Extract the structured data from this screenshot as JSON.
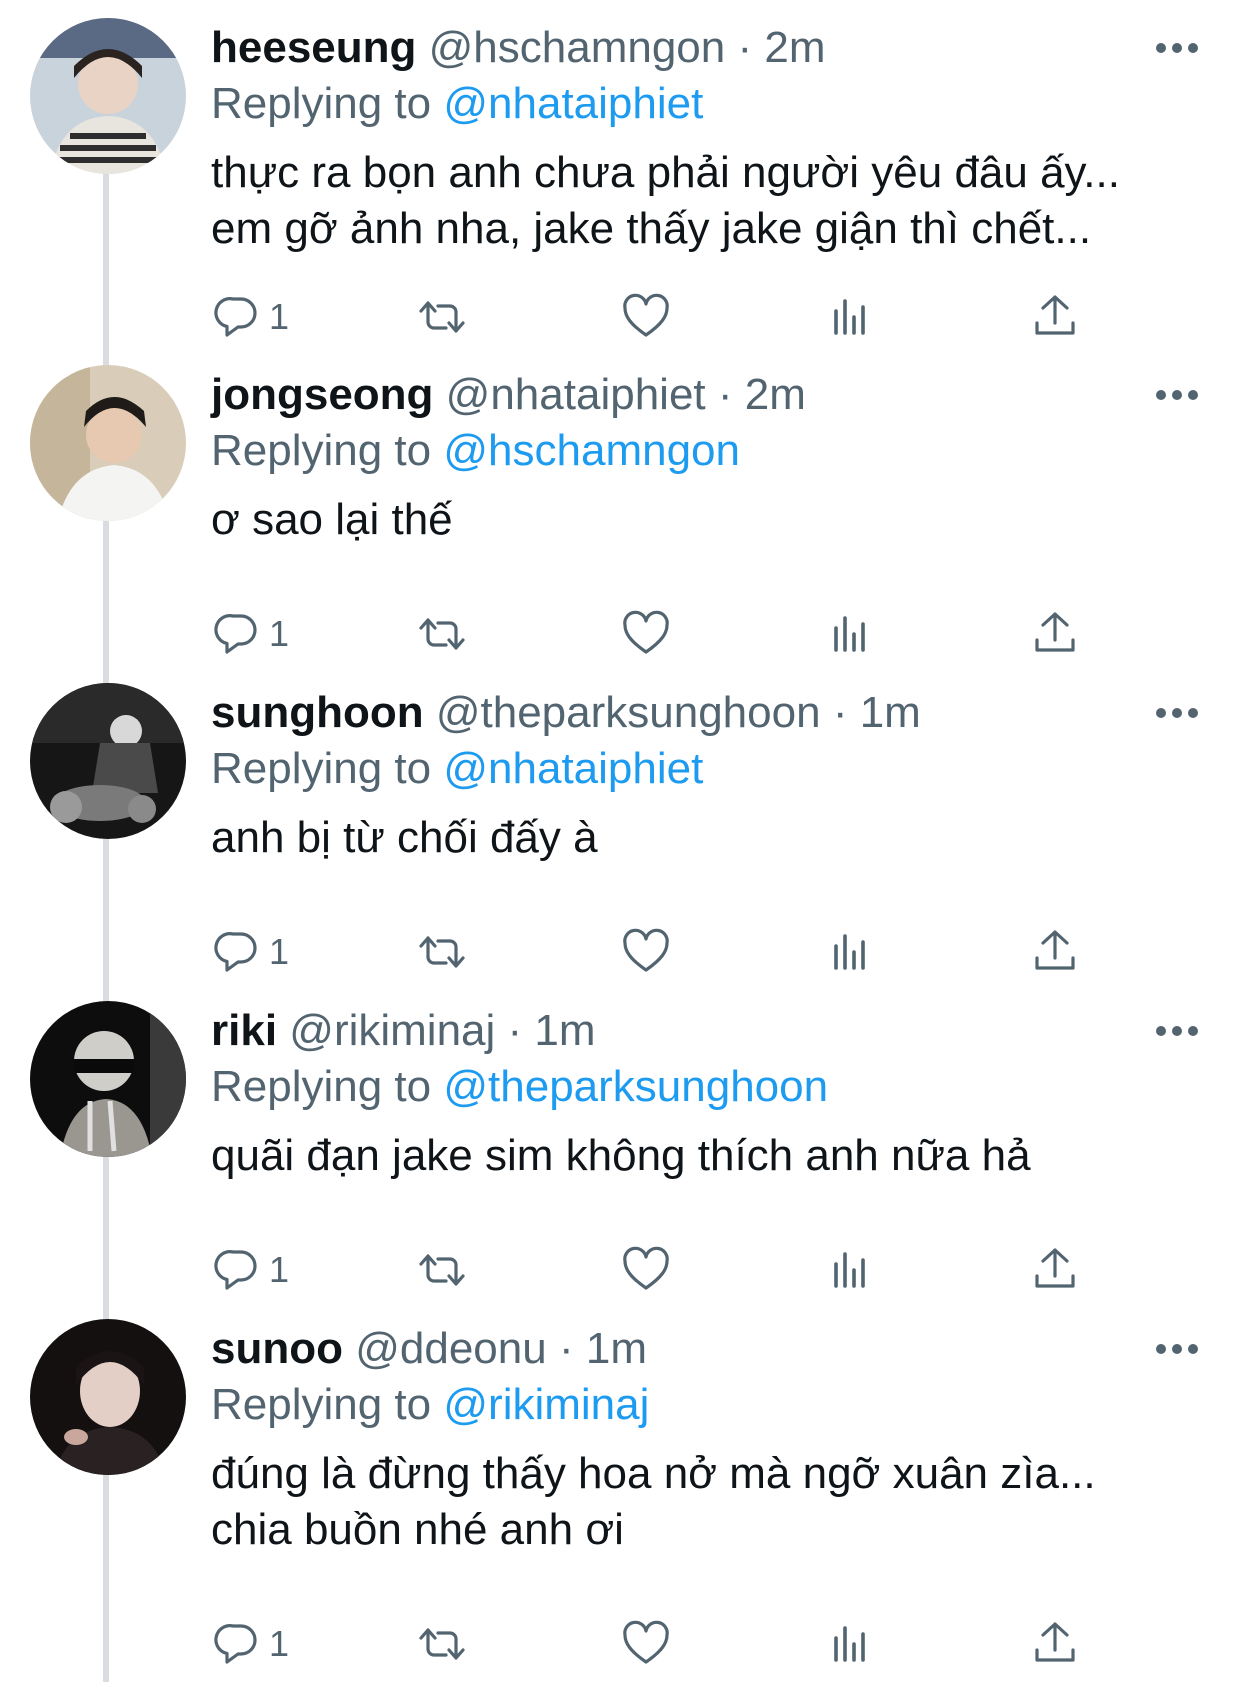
{
  "tweets": [
    {
      "name": "heeseung",
      "handle": "@hschamngon",
      "time": "2m",
      "replying_prefix": "Replying to",
      "replying_to": "@nhataiphiet",
      "lines": [
        "thực ra bọn anh chưa phải người yêu đâu ấy...",
        "em gỡ ảnh nha, jake thấy jake giận thì chết..."
      ],
      "reply_count": "1"
    },
    {
      "name": "jongseong",
      "handle": "@nhataiphiet",
      "time": "2m",
      "replying_prefix": "Replying to",
      "replying_to": "@hschamngon",
      "lines": [
        "ơ sao lại thế"
      ],
      "reply_count": "1"
    },
    {
      "name": "sunghoon",
      "handle": "@theparksunghoon",
      "time": "1m",
      "replying_prefix": "Replying to",
      "replying_to": "@nhataiphiet",
      "lines": [
        "anh bị từ chối đấy à"
      ],
      "reply_count": "1"
    },
    {
      "name": "riki",
      "handle": "@rikiminaj",
      "time": "1m",
      "replying_prefix": "Replying to",
      "replying_to": "@theparksunghoon",
      "lines": [
        "quãi đạn jake sim không thích anh nữa hả"
      ],
      "reply_count": "1"
    },
    {
      "name": "sunoo",
      "handle": "@ddeonu",
      "time": "1m",
      "replying_prefix": "Replying to",
      "replying_to": "@rikiminaj",
      "lines": [
        "đúng là đừng thấy hoa nở mà ngỡ xuân zìa...",
        "chia buồn nhé anh ơi"
      ],
      "reply_count": "1"
    }
  ],
  "colors": {
    "text": "#0f1419",
    "secondary": "#536471",
    "mention": "#1d9bf0",
    "thread_line": "#d9dde1"
  },
  "icons": [
    "reply-icon",
    "retweet-icon",
    "like-icon",
    "views-icon",
    "share-icon",
    "more-icon"
  ]
}
